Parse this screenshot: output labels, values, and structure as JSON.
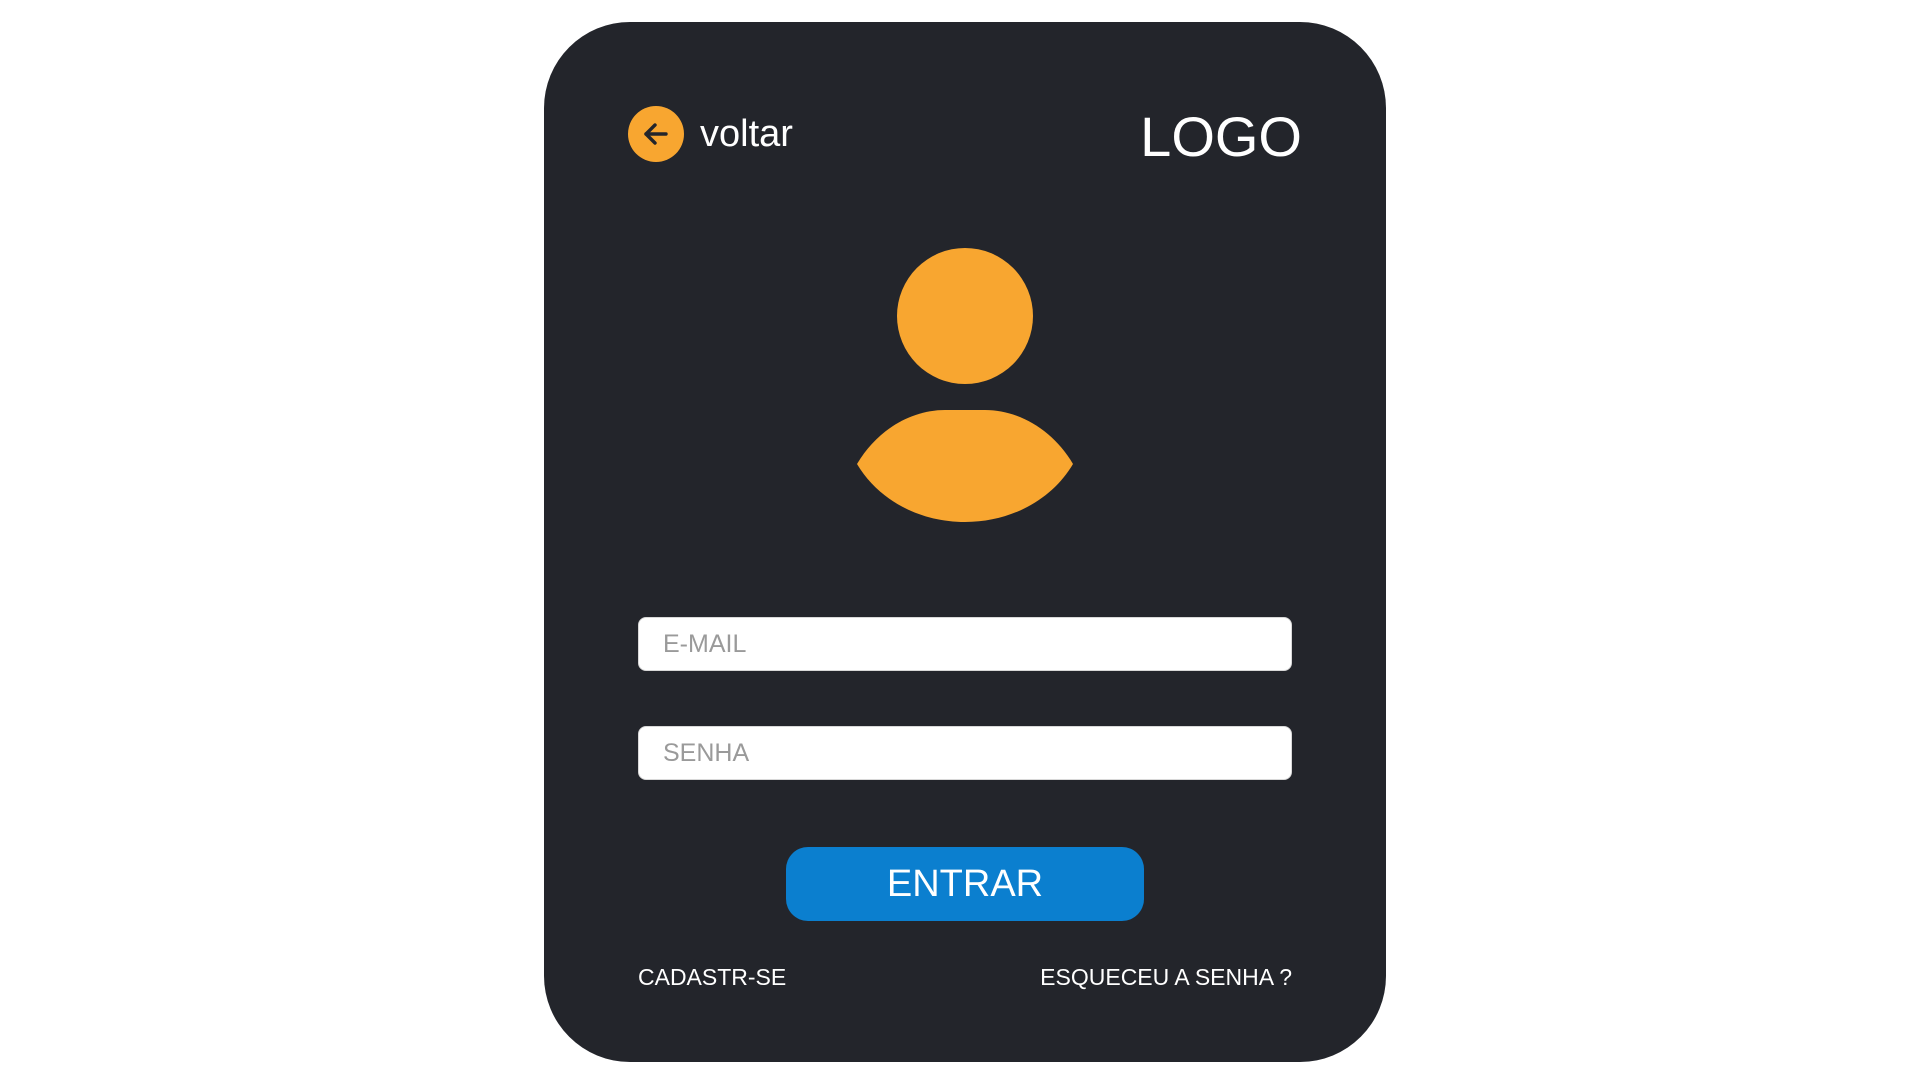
{
  "colors": {
    "page_background": "#ffffff",
    "card_background": "#23252b",
    "accent": "#f8a630",
    "primary_button": "#0b7fcf",
    "input_background": "#ffffff",
    "text": "#ffffff"
  },
  "header": {
    "back_icon": "arrow-left-icon",
    "back_label": "voltar",
    "logo_text": "LOGO"
  },
  "avatar": {
    "icon": "user-icon"
  },
  "form": {
    "email": {
      "placeholder": "E-MAIL",
      "value": ""
    },
    "password": {
      "placeholder": "SENHA",
      "value": ""
    },
    "submit_label": "ENTRAR"
  },
  "footer": {
    "signup_label": "CADASTR-SE",
    "forgot_label": "ESQUECEU A SENHA ?"
  }
}
